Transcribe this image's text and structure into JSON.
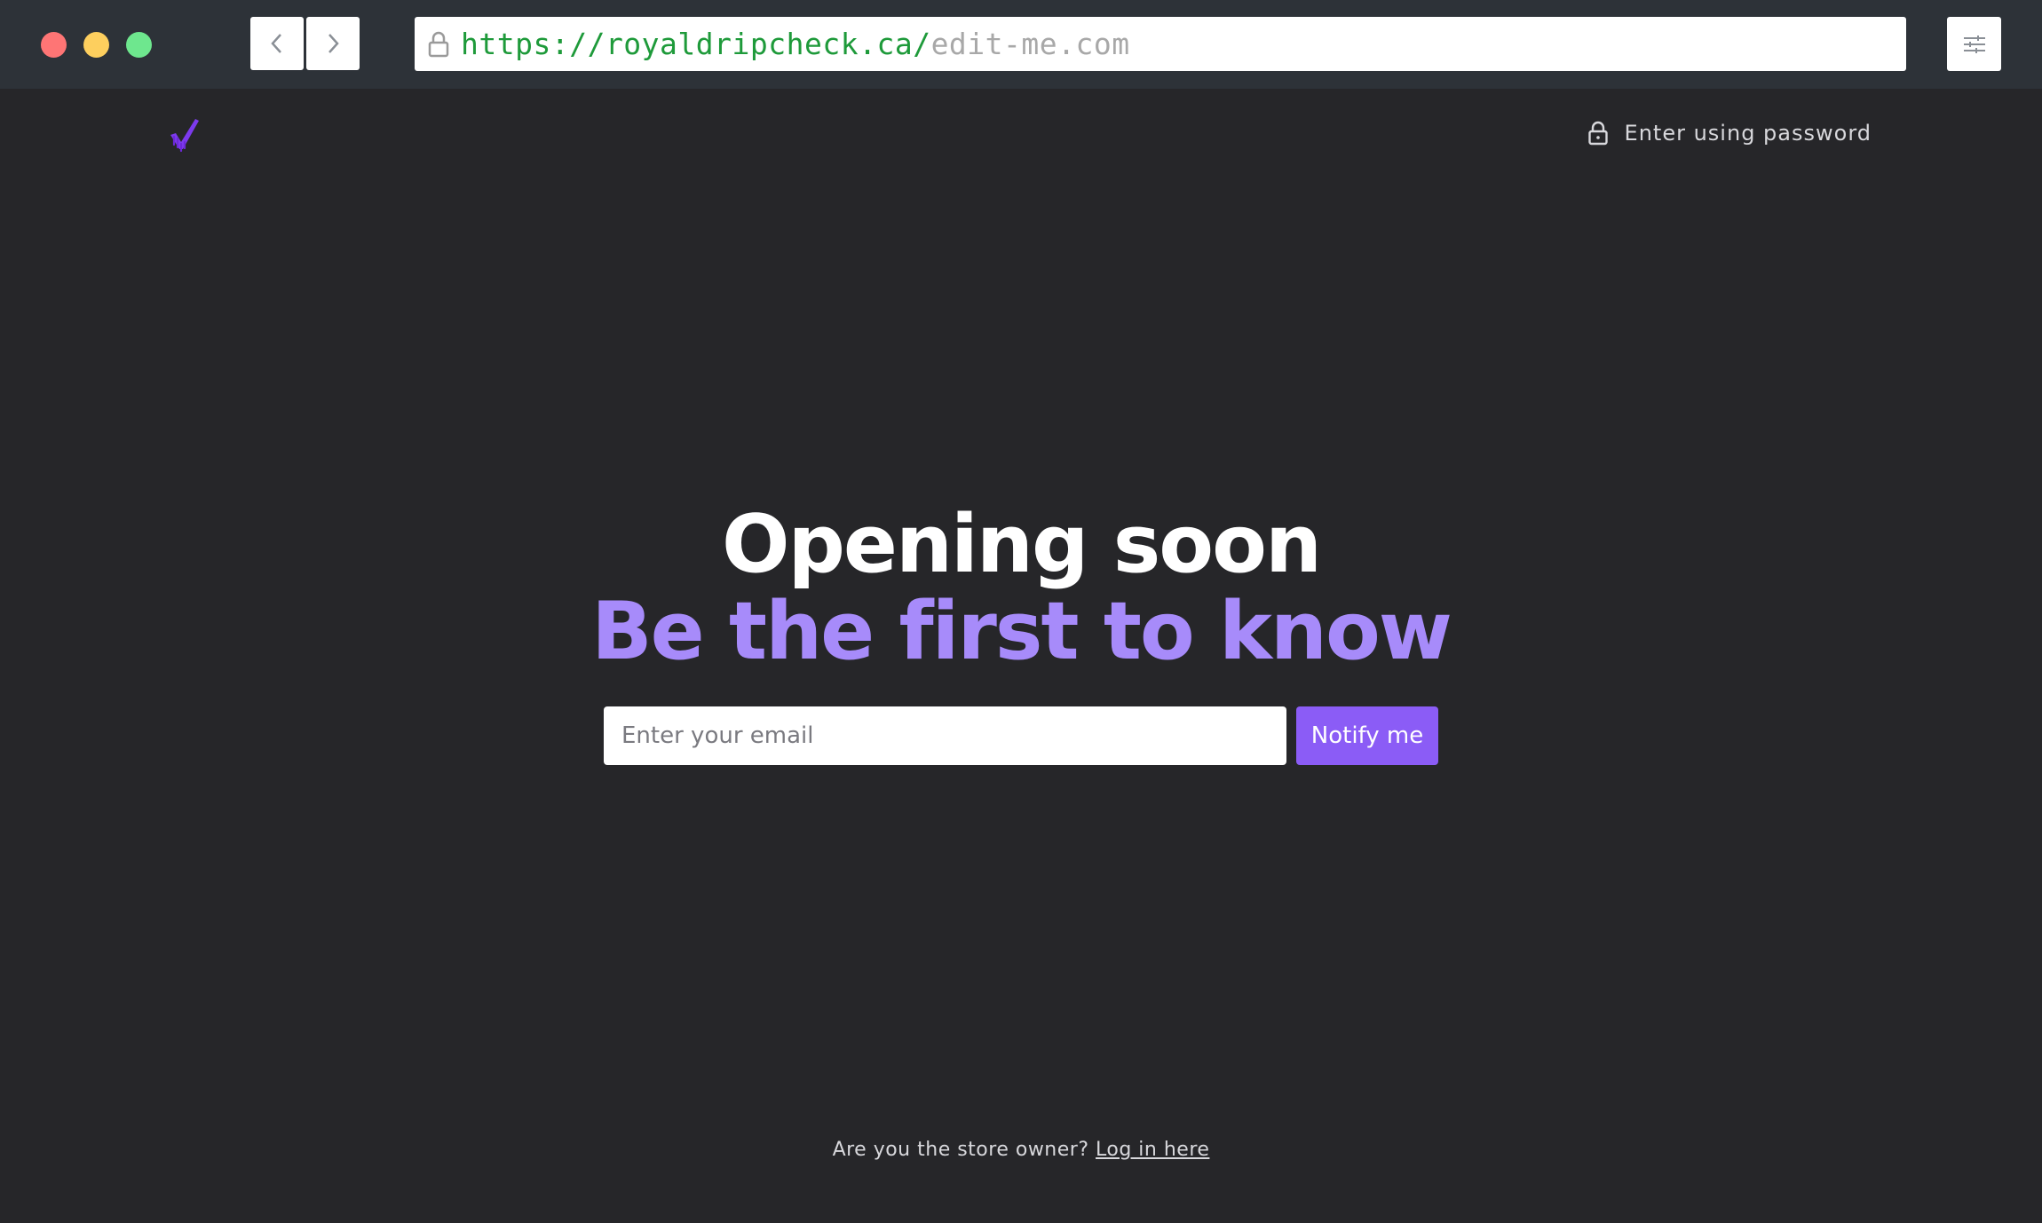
{
  "browser": {
    "url_main": "https://royaldripcheck.ca/",
    "url_ghost": "edit-me.com",
    "icons": {
      "back": "chevron-left-icon",
      "forward": "chevron-right-icon",
      "lock": "lock-icon",
      "settings": "sliders-icon"
    }
  },
  "header": {
    "logo_icon": "brand-check-logo",
    "password_link": "Enter using password"
  },
  "hero": {
    "title": "Opening soon",
    "subtitle": "Be the first to know"
  },
  "signup": {
    "email_placeholder": "Enter your email",
    "email_value": "",
    "notify_label": "Notify me"
  },
  "footer": {
    "question": "Are you the store owner?",
    "login_link": "Log in here"
  },
  "colors": {
    "page_bg": "#262629",
    "browser_bar": "#2d3238",
    "accent": "#8b5cf6",
    "subtitle": "#a78bfa",
    "url_green": "#1e9a3a"
  }
}
